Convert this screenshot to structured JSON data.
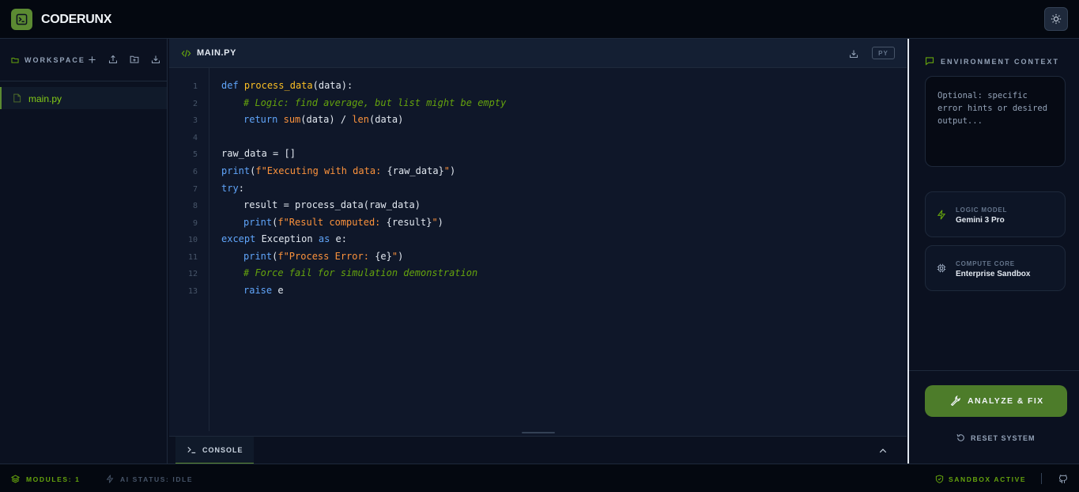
{
  "app": {
    "brand": "CODERUNX"
  },
  "sidebar": {
    "title": "WORKSPACE",
    "files": [
      {
        "name": "main.py",
        "active": true
      }
    ]
  },
  "editor": {
    "tab_name": "MAIN.PY",
    "language_badge": "PY",
    "line_numbers": [
      "1",
      "2",
      "3",
      "4",
      "5",
      "6",
      "7",
      "8",
      "9",
      "10",
      "11",
      "12",
      "13"
    ],
    "code": {
      "l1": {
        "kw": "def",
        "fn": "process_data",
        "rest": "(data):"
      },
      "l2": {
        "comment": "# Logic: find average, but list might be empty"
      },
      "l3": {
        "kw": "return",
        "b1": "sum",
        "m1": "(data) / ",
        "b2": "len",
        "m2": "(data)"
      },
      "l5": {
        "text": "raw_data = []"
      },
      "l6": {
        "kw": "print",
        "open": "(",
        "str": "f\"Executing with data: ",
        "var": "{raw_data}",
        "str_end": "\"",
        "close": ")"
      },
      "l7": {
        "kw": "try",
        "rest": ":"
      },
      "l8": {
        "text": "result = process_data(raw_data)"
      },
      "l9": {
        "kw": "print",
        "open": "(",
        "str": "f\"Result computed: ",
        "var": "{result}",
        "str_end": "\"",
        "close": ")"
      },
      "l10": {
        "kw": "except",
        "mid": " Exception ",
        "kw2": "as",
        "rest": " e:"
      },
      "l11": {
        "kw": "print",
        "open": "(",
        "str": "f\"Process Error: ",
        "var": "{e}",
        "str_end": "\"",
        "close": ")"
      },
      "l12": {
        "comment": "# Force fail for simulation demonstration"
      },
      "l13": {
        "kw": "raise",
        "rest": " e"
      }
    }
  },
  "console": {
    "label": "CONSOLE"
  },
  "right_panel": {
    "env_title": "ENVIRONMENT CONTEXT",
    "env_placeholder": "Optional: specific error hints or desired output...",
    "logic_model": {
      "label": "LOGIC MODEL",
      "value": "Gemini 3 Pro"
    },
    "compute_core": {
      "label": "COMPUTE CORE",
      "value": "Enterprise Sandbox"
    },
    "analyze_label": "ANALYZE & FIX",
    "reset_label": "RESET SYSTEM"
  },
  "status_bar": {
    "modules": "MODULES: 1",
    "ai_status": "AI STATUS: IDLE",
    "sandbox": "SANDBOX ACTIVE"
  },
  "colors": {
    "accent": "#5b8a32",
    "accent_text": "#84cc16",
    "keyword": "#60a5fa",
    "function": "#fbbf24",
    "string": "#fb923c",
    "comment": "#65a30d"
  },
  "icons": [
    "terminal-icon",
    "sun-icon",
    "folder-icon",
    "plus-icon",
    "upload-icon",
    "folder-plus-icon",
    "download-icon",
    "file-icon",
    "code-icon",
    "chat-icon",
    "bolt-icon",
    "chip-icon",
    "wrench-icon",
    "rotate-icon",
    "layers-icon",
    "shield-icon",
    "github-icon",
    "chevron-up-icon"
  ]
}
